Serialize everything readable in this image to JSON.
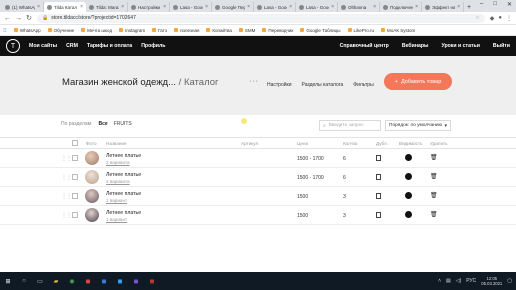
{
  "browser": {
    "tabs": [
      {
        "label": "(1) WhatsApp"
      },
      {
        "label": "Tilda Катал",
        "active": true
      },
      {
        "label": "Tilda: Магаз"
      },
      {
        "label": "Настройки"
      },
      {
        "label": "Lasa - Gooo"
      },
      {
        "label": "Google Пер"
      },
      {
        "label": "Lasa - Gooo"
      },
      {
        "label": "Lasa - Gooo"
      },
      {
        "label": "Olthanna"
      },
      {
        "label": "Подключен"
      },
      {
        "label": "Эффект на"
      }
    ],
    "new_tab": "+",
    "url": "store.tildacc/store/?projectid=1702647",
    "bookmarks": [
      "WhatsApp",
      "Обучение",
      "Мечта шкод",
      "Instagram",
      "Гатэ",
      "полезная",
      "Копайтва",
      "SMM",
      "Переводчик",
      "Google Таблицы",
      "LikePro.ru",
      "МоАК Systom"
    ]
  },
  "tilda": {
    "logo": "T",
    "nav": [
      "Мои сайты",
      "CRM",
      "Тарифы и оплата",
      "Профиль"
    ],
    "right_nav": [
      "Справочный центр",
      "Вебинары",
      "Уроки и статьи",
      "Выйти"
    ]
  },
  "header": {
    "title": "Магазин женской одежд...",
    "separator": "/",
    "subtitle": "Каталог",
    "more": "···",
    "links": [
      "Настройки",
      "Разделы каталога",
      "Фильтры"
    ],
    "add_button": "Добавить товар"
  },
  "filters": {
    "label": "По разделам:",
    "all": "Все",
    "fruits": "FRUITS",
    "search_placeholder": "Введите запрос",
    "sort_value": "Порядок: по умолчанию"
  },
  "table": {
    "headers": {
      "photo": "Фото",
      "name": "Название",
      "sku": "Артикул",
      "price": "Цена",
      "qty": "Кол-во",
      "copy": "Дубл.",
      "visible": "Видимость",
      "delete": "Удалить"
    },
    "rows": [
      {
        "name": "Летнее платье",
        "variants": "2 варианта",
        "price": "1500 - 1700",
        "qty": "6"
      },
      {
        "name": "Летнее платье",
        "variants": "2 варианта",
        "price": "1500 - 1700",
        "qty": "6"
      },
      {
        "name": "Летнее платье",
        "variants": "1 вариант",
        "price": "1500",
        "qty": "3"
      },
      {
        "name": "Летнее платье",
        "variants": "1 вариант",
        "price": "1500",
        "qty": "3"
      }
    ]
  },
  "taskbar": {
    "lang": "РУС",
    "time": "12:05",
    "date": "05.03.2021"
  }
}
